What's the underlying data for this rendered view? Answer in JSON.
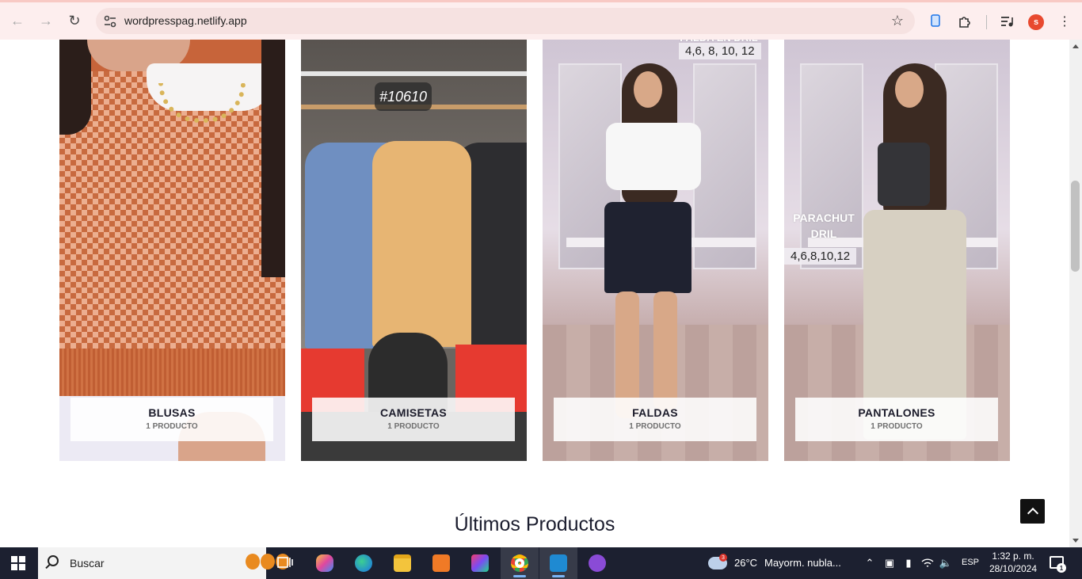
{
  "browser": {
    "url": "wordpresspag.netlify.app",
    "profile_initial": "s"
  },
  "categories": [
    {
      "name": "BLUSAS",
      "count": "1 PRODUCTO"
    },
    {
      "name": "CAMISETAS",
      "count": "1 PRODUCTO"
    },
    {
      "name": "FALDAS",
      "count": "1 PRODUCTO"
    },
    {
      "name": "PANTALONES",
      "count": "1 PRODUCTO"
    }
  ],
  "overlays": {
    "camisetas_tag": "#10610",
    "faldas_title": "FALDA EN DRIL",
    "faldas_sizes": "4,6, 8, 10, 12",
    "pantalones_title_line1": "PARACHUT",
    "pantalones_title_line2": "DRIL",
    "pantalones_sizes": "4,6,8,10,12"
  },
  "section": {
    "title": "Últimos Productos"
  },
  "taskbar": {
    "search_placeholder": "Buscar",
    "weather_temp": "26°C",
    "weather_desc": "Mayorm. nubla...",
    "weather_badge": "3",
    "language": "ESP",
    "time": "1:32 p. m.",
    "date": "28/10/2024",
    "notification_count": "1"
  },
  "colors": {
    "chrome_bg": "#fdeeee",
    "taskbar_bg": "#1c2030",
    "back_to_top_bg": "#111111",
    "profile_bg": "#e8492f"
  }
}
